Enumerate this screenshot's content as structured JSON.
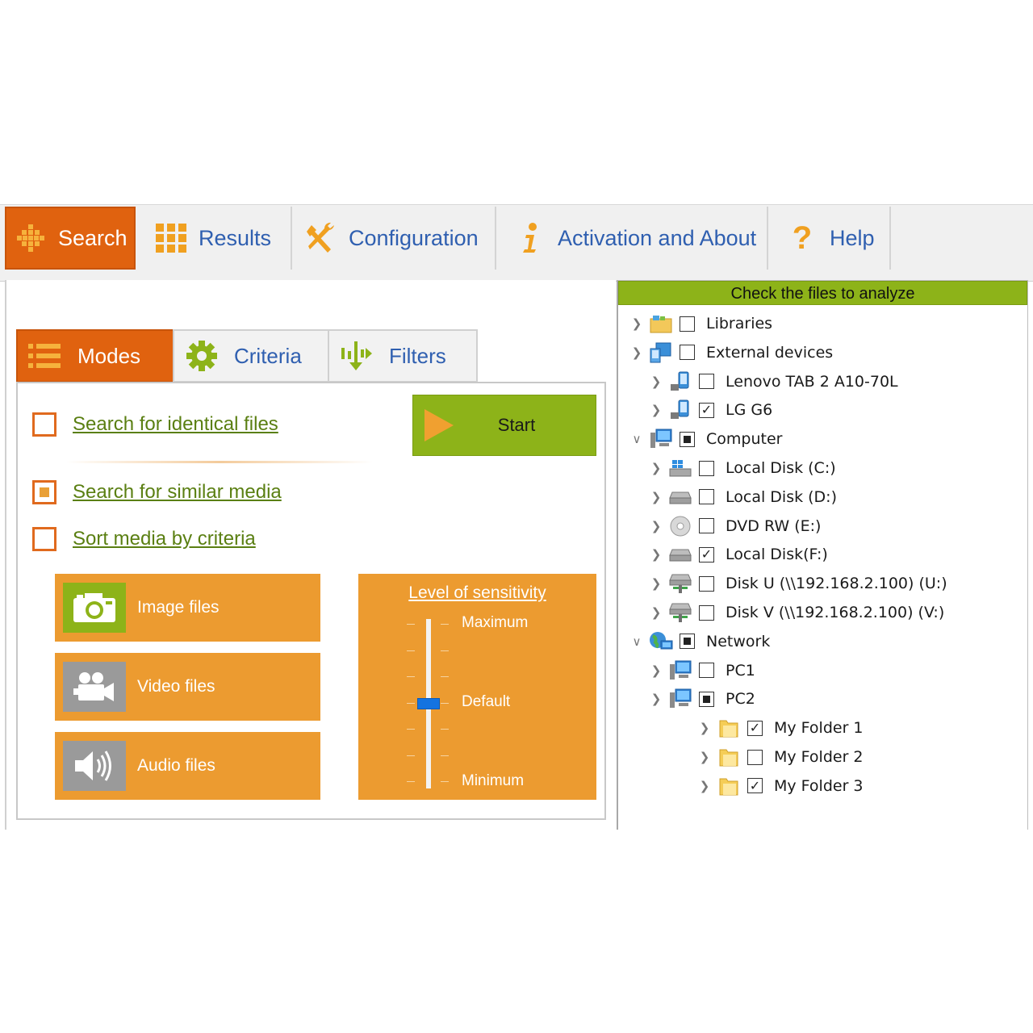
{
  "top_tabs": [
    {
      "label": "Search",
      "icon": "grid-dots-icon",
      "active": true
    },
    {
      "label": "Results",
      "icon": "results-grid-icon"
    },
    {
      "label": "Configuration",
      "icon": "tools-icon"
    },
    {
      "label": "Activation and About",
      "icon": "info-icon"
    },
    {
      "label": "Help",
      "icon": "question-icon"
    }
  ],
  "sub_tabs": [
    {
      "label": "Modes",
      "icon": "list-icon",
      "active": true
    },
    {
      "label": "Criteria",
      "icon": "gear-icon"
    },
    {
      "label": "Filters",
      "icon": "filter-icon"
    }
  ],
  "modes": {
    "identical": {
      "label": "Search for identical files",
      "checked": false
    },
    "similar": {
      "label": "Search for similar media",
      "checked": true
    },
    "sort": {
      "label": "Sort media by criteria",
      "checked": false
    },
    "start_label": "Start",
    "media": [
      {
        "label": "Image files",
        "icon": "camera-icon",
        "selected": true
      },
      {
        "label": "Video files",
        "icon": "video-camera-icon",
        "selected": false
      },
      {
        "label": "Audio files",
        "icon": "speaker-icon",
        "selected": false
      }
    ],
    "sensitivity": {
      "title": "Level of sensitivity",
      "max_label": "Maximum",
      "default_label": "Default",
      "min_label": "Minimum",
      "level": 0.5
    }
  },
  "tree": {
    "header": "Check the files to analyze",
    "items": [
      {
        "label": "Libraries",
        "check": "none",
        "icon": "libraries-icon",
        "level": 0,
        "expanded": false
      },
      {
        "label": "External devices",
        "check": "none",
        "icon": "external-devices-icon",
        "level": 0,
        "expanded": false
      },
      {
        "label": "Lenovo TAB 2 A10-70L",
        "check": "none",
        "icon": "device-icon",
        "level": 1,
        "expanded": false
      },
      {
        "label": "LG G6",
        "check": "checked",
        "icon": "device-icon",
        "level": 1,
        "expanded": false
      },
      {
        "label": "Computer",
        "check": "partial",
        "icon": "computer-icon",
        "level": 0,
        "expanded": true
      },
      {
        "label": "Local Disk (C:)",
        "check": "none",
        "icon": "system-drive-icon",
        "level": 1,
        "expanded": false
      },
      {
        "label": "Local Disk (D:)",
        "check": "none",
        "icon": "drive-icon",
        "level": 1,
        "expanded": false
      },
      {
        "label": "DVD RW (E:)",
        "check": "none",
        "icon": "dvd-icon",
        "level": 1,
        "expanded": false
      },
      {
        "label": "Local Disk(F:)",
        "check": "checked",
        "icon": "drive-icon",
        "level": 1,
        "expanded": false
      },
      {
        "label": "Disk U  (\\\\192.168.2.100) (U:)",
        "check": "none",
        "icon": "network-drive-icon",
        "level": 1,
        "expanded": false
      },
      {
        "label": "Disk V  (\\\\192.168.2.100) (V:)",
        "check": "none",
        "icon": "network-drive-icon",
        "level": 1,
        "expanded": false
      },
      {
        "label": "Network",
        "check": "partial",
        "icon": "network-icon",
        "level": 0,
        "expanded": true
      },
      {
        "label": "PC1",
        "check": "none",
        "icon": "computer-icon",
        "level": 1,
        "expanded": false
      },
      {
        "label": "PC2",
        "check": "partial",
        "icon": "computer-icon",
        "level": 1,
        "expanded": false
      },
      {
        "label": "My Folder 1",
        "check": "checked",
        "icon": "folder-icon",
        "level": 2,
        "expanded": false
      },
      {
        "label": "My Folder 2",
        "check": "none",
        "icon": "folder-icon",
        "level": 2,
        "expanded": false
      },
      {
        "label": "My Folder 3",
        "check": "checked",
        "icon": "folder-icon",
        "level": 2,
        "expanded": false
      }
    ]
  },
  "colors": {
    "accent_orange": "#e0620f",
    "media_orange": "#ec9b30",
    "green": "#8db319",
    "link_blue": "#2f5fb0",
    "link_green": "#5a7f12"
  }
}
